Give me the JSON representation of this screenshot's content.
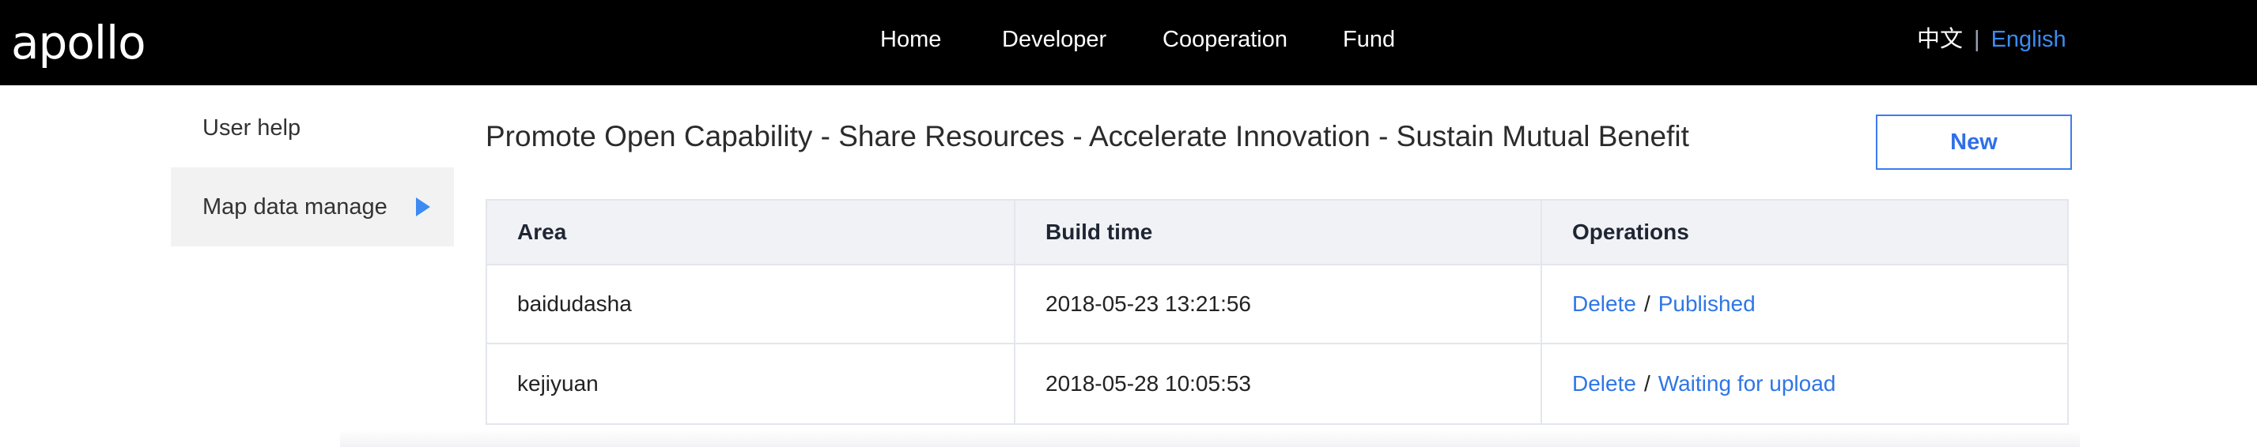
{
  "header": {
    "logo_text": "apollo",
    "nav": [
      "Home",
      "Developer",
      "Cooperation",
      "Fund"
    ],
    "lang_zh": "中文",
    "lang_separator": "|",
    "lang_en": "English"
  },
  "sidebar": {
    "items": [
      {
        "label": "User help"
      },
      {
        "label": "Map data manage"
      }
    ]
  },
  "main": {
    "headline": "Promote Open Capability - Share Resources - Accelerate Innovation - Sustain Mutual Benefit",
    "new_button": "New",
    "table": {
      "columns": [
        "Area",
        "Build time",
        "Operations"
      ],
      "rows": [
        {
          "area": "baidudasha",
          "build_time": "2018-05-23 13:21:56",
          "op_delete": "Delete",
          "op_sep": "/",
          "op_status": "Published"
        },
        {
          "area": "kejiyuan",
          "build_time": "2018-05-28 10:05:53",
          "op_delete": "Delete",
          "op_sep": "/",
          "op_status": "Waiting for upload"
        }
      ]
    }
  },
  "colors": {
    "topbar": "#000000",
    "accent": "#3d8bf2",
    "link": "#2f76e6",
    "table_header_bg": "#f1f2f6",
    "sidebar_active_bg": "#f2f2f2"
  }
}
